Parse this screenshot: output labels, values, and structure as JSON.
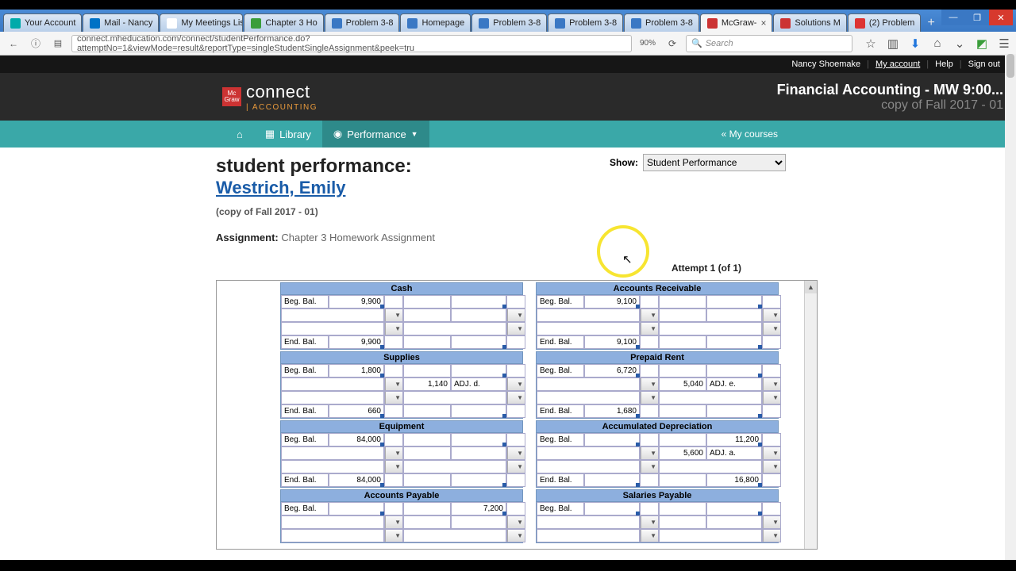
{
  "tabs": [
    {
      "label": "Your Account",
      "color": "#0aa"
    },
    {
      "label": "Mail - Nancy",
      "color": "#0072c6"
    },
    {
      "label": "My Meetings List",
      "color": "#fff"
    },
    {
      "label": "Chapter 3 Ho",
      "color": "#3a9d3a"
    },
    {
      "label": "Problem 3-8",
      "color": "#3a78c4"
    },
    {
      "label": "Homepage",
      "color": "#3a78c4"
    },
    {
      "label": "Problem 3-8",
      "color": "#3a78c4"
    },
    {
      "label": "Problem 3-8",
      "color": "#3a78c4"
    },
    {
      "label": "Problem 3-8",
      "color": "#3a78c4"
    },
    {
      "label": "McGraw-",
      "color": "#c33",
      "active": true
    },
    {
      "label": "Solutions M",
      "color": "#c33"
    },
    {
      "label": "(2) Problem",
      "color": "#d33"
    }
  ],
  "url": "connect.mheducation.com/connect/studentPerformance.do?attemptNo=1&viewMode=result&reportType=singleStudentSingleAssignment&peek=tru",
  "zoom": "90%",
  "search_placeholder": "Search",
  "toplinks": {
    "user": "Nancy Shoemake",
    "account": "My account",
    "help": "Help",
    "signout": "Sign out"
  },
  "logo": {
    "brand": "connect",
    "sub": "| ACCOUNTING"
  },
  "course": {
    "title": "Financial Accounting - MW 9:00...",
    "sub": "copy of Fall 2017 - 01"
  },
  "nav": {
    "library": "Library",
    "performance": "Performance",
    "mycourses": "« My courses"
  },
  "page": {
    "title": "student performance:",
    "student": "Westrich, Emily",
    "copy": "(copy of Fall 2017 - 01)",
    "assign_label": "Assignment:",
    "assign_value": "Chapter 3 Homework Assignment",
    "show_label": "Show:",
    "show_value": "Student Performance",
    "attempt": "Attempt 1 (of 1)"
  },
  "accounts": [
    [
      {
        "name": "Cash",
        "beg": "9,900",
        "end": "9,900"
      },
      {
        "name": "Accounts Receivable",
        "beg": "9,100",
        "end": "9,100"
      }
    ],
    [
      {
        "name": "Supplies",
        "beg": "1,800",
        "credit": "1,140",
        "credit_lbl": "ADJ. d.",
        "end": "660"
      },
      {
        "name": "Prepaid Rent",
        "beg": "6,720",
        "credit": "5,040",
        "credit_lbl": "ADJ. e.",
        "end": "1,680"
      }
    ],
    [
      {
        "name": "Equipment",
        "beg": "84,000",
        "end": "84,000"
      },
      {
        "name": "Accumulated Depreciation",
        "begc": "11,200",
        "credit": "5,600",
        "credit_lbl": "ADJ. a.",
        "endc": "16,800"
      }
    ],
    [
      {
        "name": "Accounts Payable",
        "begc": "7,200"
      },
      {
        "name": "Salaries Payable"
      }
    ]
  ],
  "labels": {
    "beg": "Beg. Bal.",
    "end": "End. Bal."
  }
}
